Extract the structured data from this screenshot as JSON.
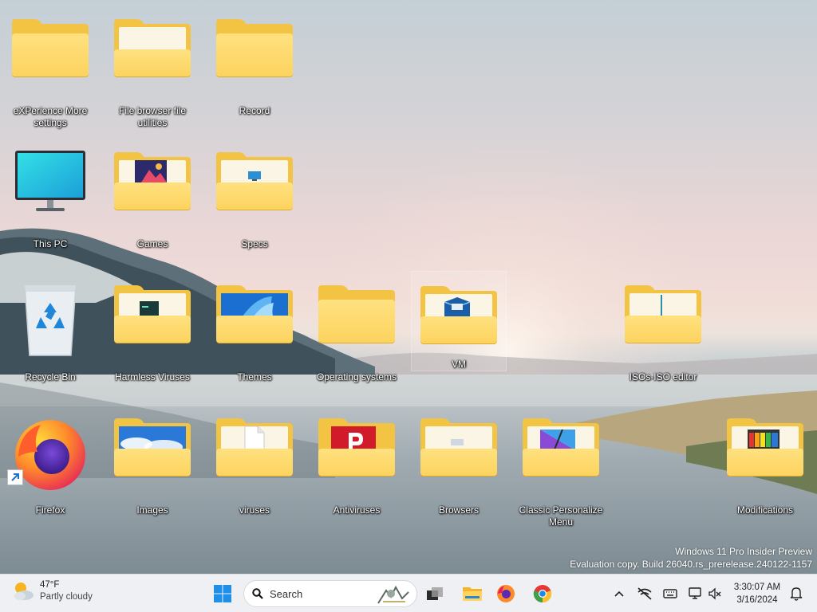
{
  "desktop": {
    "icons": [
      {
        "label": "eXPerience More settings",
        "type": "folder"
      },
      {
        "label": "File browser file utilities",
        "type": "folder"
      },
      {
        "label": "Record",
        "type": "folder"
      },
      {
        "label": "This PC",
        "type": "monitor"
      },
      {
        "label": "Games",
        "type": "folder"
      },
      {
        "label": "Specs",
        "type": "folder"
      },
      {
        "label": "Recycle Bin",
        "type": "recycle-bin"
      },
      {
        "label": "Harmless Viruses",
        "type": "folder"
      },
      {
        "label": "Themes",
        "type": "folder"
      },
      {
        "label": "Operating systems",
        "type": "folder"
      },
      {
        "label": "VM",
        "type": "folder",
        "selected": true
      },
      {
        "label": "ISOs-ISO editor",
        "type": "folder"
      },
      {
        "label": "Firefox",
        "type": "app-shortcut"
      },
      {
        "label": "Images",
        "type": "folder"
      },
      {
        "label": "viruses",
        "type": "folder"
      },
      {
        "label": "Antiviruses",
        "type": "folder"
      },
      {
        "label": "Browsers",
        "type": "folder"
      },
      {
        "label": "Classic Personalize Menu",
        "type": "folder"
      },
      {
        "label": "Modifications",
        "type": "folder"
      }
    ]
  },
  "watermark": {
    "line1": "Windows 11 Pro Insider Preview",
    "line2": "Evaluation copy. Build 26040.rs_prerelease.240122-1157"
  },
  "taskbar": {
    "weather": {
      "temp": "47°F",
      "condition": "Partly cloudy",
      "icon": "partly-cloudy-icon"
    },
    "search": {
      "placeholder": "Search"
    },
    "pinned": [
      "windows-start-icon",
      "task-view-icon",
      "file-explorer-icon",
      "firefox-icon",
      "chrome-icon"
    ],
    "tray": [
      "chevron-up-icon",
      "network-off-icon",
      "keyboard-icon",
      "display-icon",
      "volume-muted-icon"
    ],
    "clock": {
      "time": "3:30:07 AM",
      "date": "3/16/2024"
    },
    "notification": "bell-icon"
  },
  "colors": {
    "folder": "#f3c344",
    "folder_front": "#fcd35f",
    "taskbar": "#eef0f3",
    "windows_blue": "#1e90e8"
  }
}
